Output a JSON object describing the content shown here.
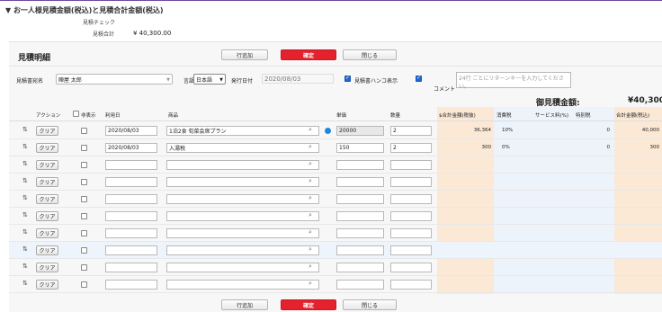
{
  "summary": {
    "title": "▼ お一人様見積金額(税込)と見積合計金額(税込)",
    "check_label": "見積チェック",
    "total_label": "見積合計",
    "total_value": "¥ 40,300.00"
  },
  "panel": {
    "heading": "見積明細",
    "add_row": "行追加",
    "confirm": "確定",
    "close": "閉じる"
  },
  "form": {
    "addressee_label": "見積書宛名",
    "addressee_value": "陣屋 太郎",
    "language_label": "言語",
    "language_value": "日本語",
    "issue_date_label": "発行日付",
    "issue_date_value": "2020/08/03",
    "stamp_label": "見積書ハンコ表示",
    "comment_label": "コメント",
    "comment_placeholder": "24行 ごとにリターンキーを入力してください。",
    "grand_label": "御見積金額:",
    "grand_value": "¥40,300"
  },
  "table": {
    "headers": {
      "action": "アクション",
      "hide": "非表示",
      "date": "利用日",
      "item": "商品",
      "price": "単価",
      "qty": "数量",
      "subtotal": "$合計金額(税抜)",
      "tax": "消費税",
      "service": "サービス料(%)",
      "special": "特別税",
      "total": "合計金額(税込)"
    },
    "clear_label": "クリア",
    "rows": [
      {
        "date": "2020/08/03",
        "item": "1泊2食 旬菜会席プラン",
        "price": "20000",
        "qty": "2",
        "subtotal": "36,364",
        "tax": "10%",
        "special": "0",
        "total": "40,000"
      },
      {
        "date": "2020/08/03",
        "item": "入湯税",
        "price": "150",
        "qty": "2",
        "subtotal": "300",
        "tax": "0%",
        "special": "0",
        "total": "300"
      },
      {
        "date": "",
        "item": "",
        "price": "",
        "qty": "",
        "subtotal": "",
        "tax": "",
        "special": "",
        "total": ""
      },
      {
        "date": "",
        "item": "",
        "price": "",
        "qty": "",
        "subtotal": "",
        "tax": "",
        "special": "",
        "total": ""
      },
      {
        "date": "",
        "item": "",
        "price": "",
        "qty": "",
        "subtotal": "",
        "tax": "",
        "special": "",
        "total": ""
      },
      {
        "date": "",
        "item": "",
        "price": "",
        "qty": "",
        "subtotal": "",
        "tax": "",
        "special": "",
        "total": ""
      },
      {
        "date": "",
        "item": "",
        "price": "",
        "qty": "",
        "subtotal": "",
        "tax": "",
        "special": "",
        "total": ""
      },
      {
        "date": "",
        "item": "",
        "price": "",
        "qty": "",
        "subtotal": "",
        "tax": "",
        "special": "",
        "total": ""
      },
      {
        "date": "",
        "item": "",
        "price": "",
        "qty": "",
        "subtotal": "",
        "tax": "",
        "special": "",
        "total": ""
      },
      {
        "date": "",
        "item": "",
        "price": "",
        "qty": "",
        "subtotal": "",
        "tax": "",
        "special": "",
        "total": ""
      }
    ]
  },
  "colors": {
    "accent_red": "#e3222d",
    "purple_bar": "#6b4b9e",
    "check_blue": "#2166d5",
    "column_tint": "#fbe9d6"
  }
}
